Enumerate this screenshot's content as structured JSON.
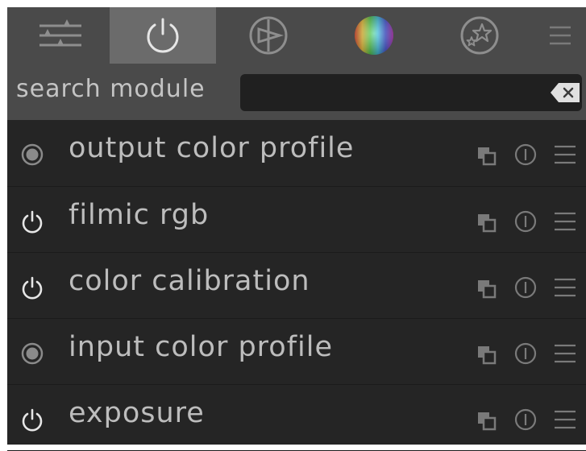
{
  "tabs": [
    {
      "icon": "sliders-icon",
      "active": false
    },
    {
      "icon": "power-icon",
      "active": true
    },
    {
      "icon": "lens-triangle-icon",
      "active": false
    },
    {
      "icon": "color-wheel-icon",
      "active": false
    },
    {
      "icon": "favorites-stars-icon",
      "active": false
    }
  ],
  "search": {
    "label": "search module",
    "value": "",
    "placeholder": ""
  },
  "modules": [
    {
      "name": "output color profile",
      "state": "always-on"
    },
    {
      "name": "filmic rgb",
      "state": "power"
    },
    {
      "name": "color calibration",
      "state": "power"
    },
    {
      "name": "input color profile",
      "state": "always-on"
    },
    {
      "name": "exposure",
      "state": "power"
    }
  ],
  "colors": {
    "panel_bg": "#252525",
    "header_bg": "#4a4a4a",
    "active_tab_bg": "#6b6b6b",
    "text": "#bdbdbd"
  }
}
